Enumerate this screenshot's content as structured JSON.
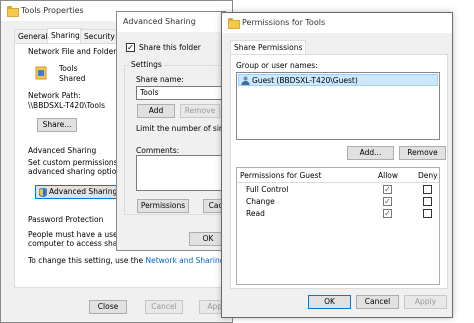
{
  "tools_properties": {
    "title": "Tools Properties",
    "tabs": [
      "General",
      "Sharing",
      "Security"
    ],
    "network_group_label": "Network File and Folder Sharing",
    "folder_name": "Tools",
    "folder_status": "Shared",
    "network_path_label": "Network Path:",
    "network_path_value": "\\\\BBDSXL-T420\\Tools",
    "share_button": "Share...",
    "advanced_group_label": "Advanced Sharing",
    "advanced_desc_1": "Set custom permissions, cre",
    "advanced_desc_2": "advanced sharing options.",
    "advanced_sharing_button": "Advanced Sharing...",
    "password_group_label": "Password Protection",
    "password_desc_1": "People must have a user ac",
    "password_desc_2": "computer to access shared",
    "change_setting_prefix": "To change this setting, use the",
    "change_setting_link": "Network and Sharing Centre",
    "close_button": "Close",
    "cancel_button": "Cancel",
    "apply_button": "Apply"
  },
  "advanced_sharing": {
    "title": "Advanced Sharing",
    "share_folder_label": "Share this folder",
    "settings_label": "Settings",
    "share_name_label": "Share name:",
    "share_name_value": "Tools",
    "add_button": "Add",
    "remove_button": "Remove",
    "limit_label": "Limit the number of simulta",
    "comments_label": "Comments:",
    "permissions_button": "Permissions",
    "caching_button": "Cach",
    "ok_button": "OK"
  },
  "permissions": {
    "title": "Permissions for Tools",
    "tab": "Share Permissions",
    "group_label": "Group or user names:",
    "users": [
      {
        "name": "Guest (BBDSXL-T420\\Guest)",
        "icon": "user-icon"
      }
    ],
    "add_button": "Add...",
    "remove_button": "Remove",
    "permissions_for_label": "Permissions for Guest",
    "allow_header": "Allow",
    "deny_header": "Deny",
    "rows": [
      {
        "name": "Full Control",
        "allow": true,
        "deny": false
      },
      {
        "name": "Change",
        "allow": true,
        "deny": false
      },
      {
        "name": "Read",
        "allow": true,
        "deny": false
      }
    ],
    "ok_button": "OK",
    "cancel_button": "Cancel",
    "apply_button": "Apply"
  }
}
